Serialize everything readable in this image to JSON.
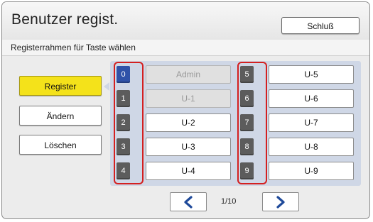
{
  "window": {
    "title": "Benutzer regist."
  },
  "header": {
    "exit_label": "Schluß"
  },
  "subtitle": "Registerrahmen für Taste wählen",
  "sidebar": {
    "buttons": [
      {
        "label": "Register",
        "active": true
      },
      {
        "label": "Ändern",
        "active": false
      },
      {
        "label": "Löschen",
        "active": false
      }
    ]
  },
  "slots": [
    {
      "num": "0",
      "label": "Admin",
      "selected": true,
      "disabled": true
    },
    {
      "num": "1",
      "label": "U-1",
      "selected": false,
      "disabled": true
    },
    {
      "num": "2",
      "label": "U-2",
      "selected": false,
      "disabled": false
    },
    {
      "num": "3",
      "label": "U-3",
      "selected": false,
      "disabled": false
    },
    {
      "num": "4",
      "label": "U-4",
      "selected": false,
      "disabled": false
    },
    {
      "num": "5",
      "label": "U-5",
      "selected": false,
      "disabled": false
    },
    {
      "num": "6",
      "label": "U-6",
      "selected": false,
      "disabled": false
    },
    {
      "num": "7",
      "label": "U-7",
      "selected": false,
      "disabled": false
    },
    {
      "num": "8",
      "label": "U-8",
      "selected": false,
      "disabled": false
    },
    {
      "num": "9",
      "label": "U-9",
      "selected": false,
      "disabled": false
    }
  ],
  "pagination": {
    "page": "1/10",
    "prev_icon": "chevron-left-icon",
    "next_icon": "chevron-right-icon"
  },
  "colors": {
    "active_button": "#f4e21a",
    "selected_number": "#2f52a8",
    "highlight_frame": "#d42020",
    "chevron": "#1f4a9a",
    "panel": "#cfd7e6"
  }
}
